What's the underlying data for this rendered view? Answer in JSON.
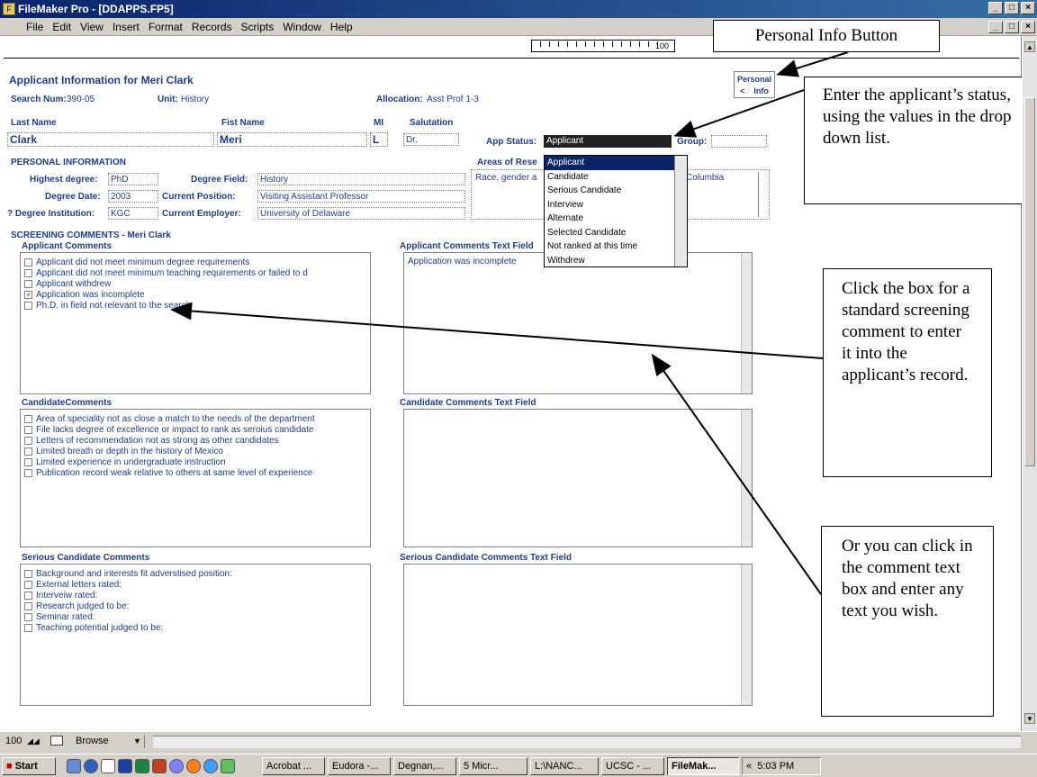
{
  "window": {
    "title": "FileMaker Pro - [DDAPPS.FP5]",
    "app_icon": "filemaker-icon",
    "min": "_",
    "max": "□",
    "close": "×",
    "doc_min": "_",
    "doc_max": "□",
    "doc_close": "×"
  },
  "menu": [
    "File",
    "Edit",
    "View",
    "Insert",
    "Format",
    "Records",
    "Scripts",
    "Window",
    "Help"
  ],
  "ruler": {
    "label": "100"
  },
  "header": {
    "title": "Applicant Information for Meri Clark",
    "search_num_label": "Search Num:",
    "search_num": "390-05",
    "unit_label": "Unit:",
    "unit": "History",
    "allocation_label": "Allocation:",
    "allocation": "Asst Prof 1-3",
    "personal_button_line1": "Personal",
    "personal_button_line2": "<    Info"
  },
  "name": {
    "last_label": "Last Name",
    "last": "Clark",
    "first_label": "Fist Name",
    "first": "Meri",
    "mi_label": "MI",
    "mi": "L",
    "salutation_label": "Salutation",
    "salutation": "Dr.",
    "app_status_label": "App Status:",
    "app_status": "Applicant",
    "group_label": "Group:",
    "group": ""
  },
  "personal": {
    "section": "PERSONAL INFORMATION",
    "highest_degree_label": "Highest degree:",
    "highest_degree": "PhD",
    "degree_field_label": "Degree Field:",
    "degree_field": "History",
    "degree_date_label": "Degree Date:",
    "degree_date": "2003",
    "current_position_label": "Current Position:",
    "current_position": "Visiting Assistant Professor",
    "degree_inst_label": "? Degree Institution:",
    "degree_inst": "KGC",
    "current_employer_label": "Current Employer:",
    "current_employer": "University of Delaware",
    "areas_label": "Areas of Rese",
    "areas_value": "Race, gender a",
    "areas_value_right": "Columbia"
  },
  "status_options": [
    "Applicant",
    "Candidate",
    "Serious Candidate",
    "Interview",
    "Alternate",
    "Selected Candidate",
    "Not ranked at this time",
    "Withdrew"
  ],
  "screening": {
    "section": "SCREENING COMMENTS - Meri Clark",
    "applicant": {
      "title": "Applicant Comments",
      "items": [
        {
          "label": "Applicant did not meet minimum degree requirements",
          "mark": ""
        },
        {
          "label": "Applicant did not meet minimum teaching requirements or failed to d",
          "mark": ""
        },
        {
          "label": "Applicant withdrew",
          "mark": ""
        },
        {
          "label": "Application was incomplete",
          "mark": "×"
        },
        {
          "label": "Ph.D. in field not relevant to the search",
          "mark": ""
        }
      ],
      "text_title": "Applicant Comments Text Field",
      "text": "Application was incomplete"
    },
    "candidate": {
      "title": "CandidateComments",
      "items": [
        "Area of speciality not as close a match to the needs of the department",
        "File lacks degree of excellence or impact to rank as seroius candidate",
        "Letters of recommendation not as strong as other candidates",
        "Limited breath or depth in the history of Mexico",
        "Limited experience in undergraduate instruction",
        "Publication record weak relative to others at same level of experience"
      ],
      "text_title": "Candidate Comments Text Field"
    },
    "serious": {
      "title": "Serious Candidate Comments",
      "items": [
        "Background and interests fit adverstised position:",
        "External letters rated:",
        "Interveiw rated:",
        "Research judged to be:",
        "Seminar rated:",
        "Teaching potential judged to be:"
      ],
      "text_title": "Serious Candidate Comments Text Field"
    }
  },
  "callouts": {
    "personal_info": "Personal Info Button",
    "status": "Enter the applicant’s status, using the values in the drop down list.",
    "click_box": "Click the box for a standard screening comment to enter it into the applicant’s record.",
    "text_box": "Or you can click in the comment text box and enter any text you wish."
  },
  "statusbar": {
    "zoom": "100",
    "mode": "Browse"
  },
  "taskbar": {
    "start": "Start",
    "tasks": [
      "Acrobat ...",
      "Eudora -...",
      "Degnan,...",
      "5 Micr...",
      "L:\\NANC...",
      "UCSC - ...",
      "FileMak..."
    ],
    "chevron": "«",
    "clock": "5:03 PM"
  }
}
